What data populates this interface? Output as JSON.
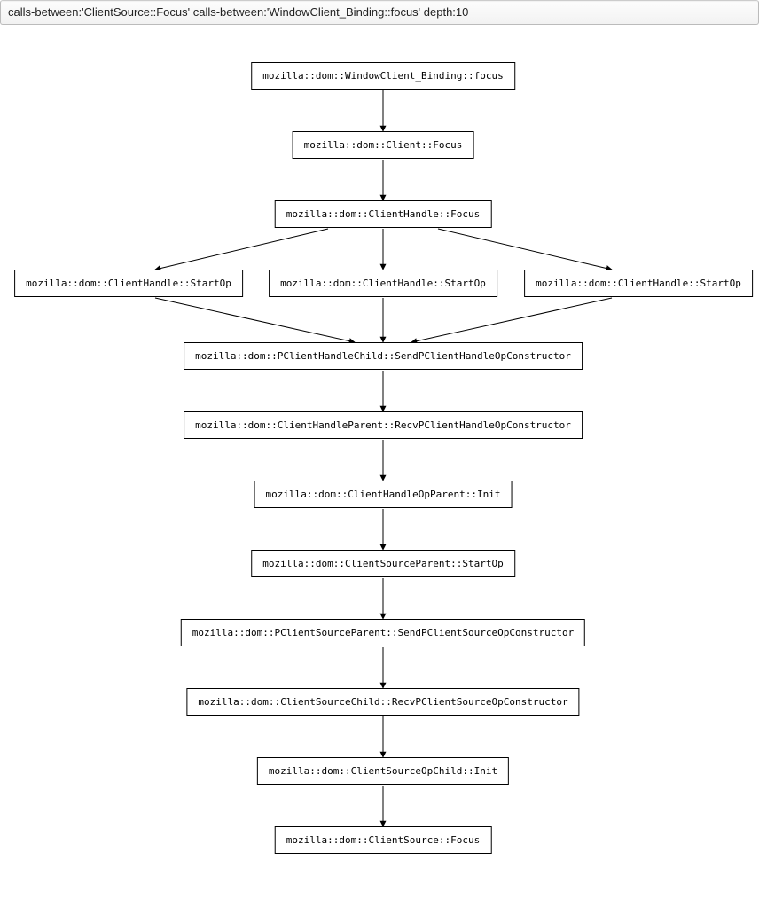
{
  "search": {
    "value": "calls-between:'ClientSource::Focus' calls-between:'WindowClient_Binding::focus' depth:10"
  },
  "nodes": {
    "n0": "mozilla::dom::WindowClient_Binding::focus",
    "n1": "mozilla::dom::Client::Focus",
    "n2": "mozilla::dom::ClientHandle::Focus",
    "n3a": "mozilla::dom::ClientHandle::StartOp",
    "n3b": "mozilla::dom::ClientHandle::StartOp",
    "n3c": "mozilla::dom::ClientHandle::StartOp",
    "n4": "mozilla::dom::PClientHandleChild::SendPClientHandleOpConstructor",
    "n5": "mozilla::dom::ClientHandleParent::RecvPClientHandleOpConstructor",
    "n6": "mozilla::dom::ClientHandleOpParent::Init",
    "n7": "mozilla::dom::ClientSourceParent::StartOp",
    "n8": "mozilla::dom::PClientSourceParent::SendPClientSourceOpConstructor",
    "n9": "mozilla::dom::ClientSourceChild::RecvPClientSourceOpConstructor",
    "n10": "mozilla::dom::ClientSourceOpChild::Init",
    "n11": "mozilla::dom::ClientSource::Focus"
  }
}
